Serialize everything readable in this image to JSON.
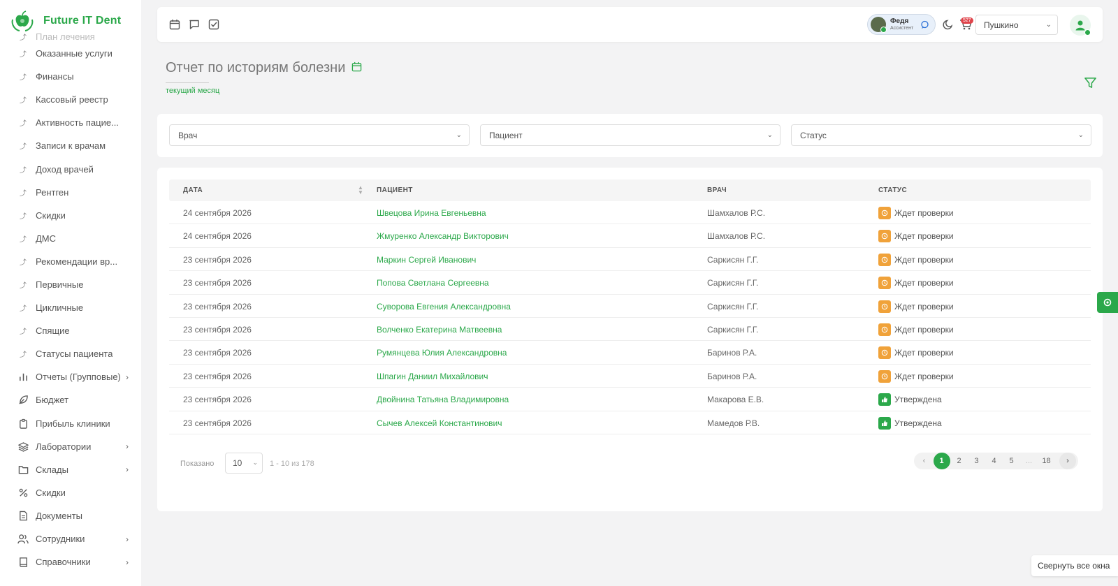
{
  "app": {
    "logo_text": "Future IT Dent"
  },
  "sidebar": {
    "faded_item": "План лечения",
    "sub_items": [
      "Оказанные услуги",
      "Финансы",
      "Кассовый реестр",
      "Активность пацие...",
      "Записи к врачам",
      "Доход врачей",
      "Рентген",
      "Скидки",
      "ДМС",
      "Рекомендации вр...",
      "Первичные",
      "Цикличные",
      "Спящие",
      "Статусы пациента"
    ],
    "main_items": [
      {
        "label": "Отчеты (Групповые)",
        "icon": "bar-chart-icon",
        "has_children": true
      },
      {
        "label": "Бюджет",
        "icon": "leaf-icon",
        "has_children": false
      },
      {
        "label": "Прибыль клиники",
        "icon": "clipboard-icon",
        "has_children": false
      },
      {
        "label": "Лаборатории",
        "icon": "layers-icon",
        "has_children": true
      },
      {
        "label": "Склады",
        "icon": "folder-icon",
        "has_children": true
      },
      {
        "label": "Скидки",
        "icon": "percent-icon",
        "has_children": false
      },
      {
        "label": "Документы",
        "icon": "document-icon",
        "has_children": false
      },
      {
        "label": "Сотрудники",
        "icon": "users-icon",
        "has_children": true
      },
      {
        "label": "Справочники",
        "icon": "book-icon",
        "has_children": true
      }
    ]
  },
  "topbar": {
    "user_name": "Федя",
    "user_role": "Ассистент",
    "cart_badge": "527",
    "branch": "Пушкино"
  },
  "page": {
    "title": "Отчет по историям болезни",
    "period": "текущий месяц"
  },
  "filters": {
    "doctor_placeholder": "Врач",
    "patient_placeholder": "Пациент",
    "status_placeholder": "Статус"
  },
  "table": {
    "columns": {
      "date": "ДАТА",
      "patient": "ПАЦИЕНТ",
      "doctor": "ВРАЧ",
      "status": "СТАТУС"
    },
    "rows": [
      {
        "date": "24 сентября 2026",
        "patient": "Швецова Ирина Евгеньевна",
        "doctor": "Шамхалов Р.С.",
        "status": "Ждет проверки",
        "status_type": "wait"
      },
      {
        "date": "24 сентября 2026",
        "patient": "Жмуренко Александр Викторович",
        "doctor": "Шамхалов Р.С.",
        "status": "Ждет проверки",
        "status_type": "wait"
      },
      {
        "date": "23 сентября 2026",
        "patient": "Маркин Сергей Иванович",
        "doctor": "Саркисян Г.Г.",
        "status": "Ждет проверки",
        "status_type": "wait"
      },
      {
        "date": "23 сентября 2026",
        "patient": "Попова Светлана Сергеевна",
        "doctor": "Саркисян Г.Г.",
        "status": "Ждет проверки",
        "status_type": "wait"
      },
      {
        "date": "23 сентября 2026",
        "patient": "Суворова Евгения Александровна",
        "doctor": "Саркисян Г.Г.",
        "status": "Ждет проверки",
        "status_type": "wait"
      },
      {
        "date": "23 сентября 2026",
        "patient": "Волченко Екатерина Матвеевна",
        "doctor": "Саркисян Г.Г.",
        "status": "Ждет проверки",
        "status_type": "wait"
      },
      {
        "date": "23 сентября 2026",
        "patient": "Румянцева Юлия Александровна",
        "doctor": "Баринов Р.А.",
        "status": "Ждет проверки",
        "status_type": "wait"
      },
      {
        "date": "23 сентября 2026",
        "patient": "Шпагин Даниил Михайлович",
        "doctor": "Баринов Р.А.",
        "status": "Ждет проверки",
        "status_type": "wait"
      },
      {
        "date": "23 сентября 2026",
        "patient": "Двойнина Татьяна Владимировна",
        "doctor": "Макарова Е.В.",
        "status": "Утверждена",
        "status_type": "ok"
      },
      {
        "date": "23 сентября 2026",
        "patient": "Сычев Алексей Константинович",
        "doctor": "Мамедов Р.В.",
        "status": "Утверждена",
        "status_type": "ok"
      }
    ]
  },
  "pagination": {
    "shown_label": "Показано",
    "per_page": "10",
    "range": "1 - 10 из 178",
    "pages": [
      "1",
      "2",
      "3",
      "4",
      "5",
      "...",
      "18"
    ],
    "active_page": "1"
  },
  "collapse_all": "Свернуть все окна",
  "colors": {
    "accent": "#2ba84a",
    "wait": "#f0a23a",
    "badge": "#e0444b"
  }
}
